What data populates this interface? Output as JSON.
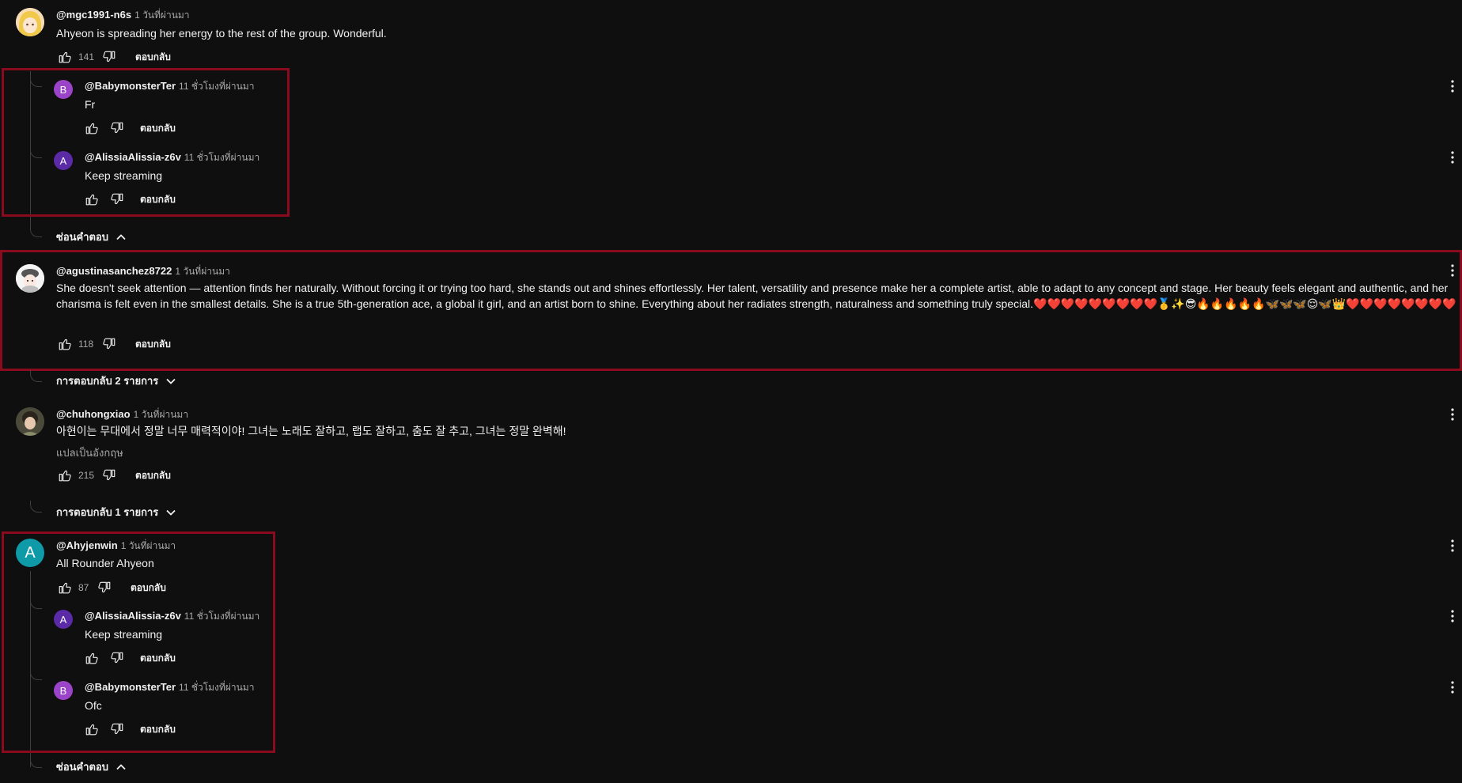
{
  "colors": {
    "background": "#0f0f0f",
    "highlight": "#8a0b1d",
    "avatar_purple": "#9c44c9",
    "avatar_indigo": "#5b2aa6",
    "avatar_teal": "#0f9aa8"
  },
  "labels": {
    "reply": "ตอบกลับ",
    "hide_replies": "ซ่อนคำตอบ",
    "translate": "แปลเป็นอังกฤษ"
  },
  "comments": [
    {
      "handle": "@mgc1991-n6s",
      "time": "1 วันที่ผ่านมา",
      "text": "Ahyeon is spreading her energy to the rest of the group. Wonderful.",
      "likes": "141"
    },
    {
      "handle": "@agustinasanchez8722",
      "time": "1 วันที่ผ่านมา",
      "text": "She doesn't seek attention — attention finds her naturally. Without forcing it or trying too hard, she stands out and shines effortlessly. Her talent, versatility and presence make her a complete artist, able to adapt to any concept and stage. Her beauty feels elegant and authentic, and her charisma is felt even in the smallest details. She is a true 5th-generation ace, a global it girl, and an artist born to shine. Everything about her radiates strength, naturalness and something truly special.❤️❤️❤️❤️❤️❤️❤️❤️❤️🥇✨😎🔥🔥🔥🔥🔥🦋🦋🦋😌🦋👑❤️❤️❤️❤️❤️❤️❤️❤️",
      "likes": "118",
      "replies_toggle": "การตอบกลับ 2 รายการ"
    },
    {
      "handle": "@chuhongxiao",
      "time": "1 วันที่ผ่านมา",
      "text": "아현이는 무대에서 정말 너무 매력적이야! 그녀는 노래도 잘하고, 랩도 잘하고, 춤도 잘 추고, 그녀는 정말 완벽해!",
      "likes": "215",
      "replies_toggle": "การตอบกลับ 1 รายการ"
    },
    {
      "handle": "@Ahyjenwin",
      "time": "1 วันที่ผ่านมา",
      "text": "All Rounder Ahyeon",
      "likes": "87",
      "avatar_letter": "A"
    }
  ],
  "replies": [
    {
      "handle": "@BabymonsterTer",
      "time": "11 ชั่วโมงที่ผ่านมา",
      "text": "Fr",
      "avatar_letter": "B"
    },
    {
      "handle": "@AlissiaAlissia-z6v",
      "time": "11 ชั่วโมงที่ผ่านมา",
      "text": "Keep streaming",
      "avatar_letter": "A"
    },
    {
      "handle": "@AlissiaAlissia-z6v",
      "time": "11 ชั่วโมงที่ผ่านมา",
      "text": "Keep streaming",
      "avatar_letter": "A"
    },
    {
      "handle": "@BabymonsterTer",
      "time": "11 ชั่วโมงที่ผ่านมา",
      "text": "Ofc",
      "avatar_letter": "B"
    }
  ]
}
